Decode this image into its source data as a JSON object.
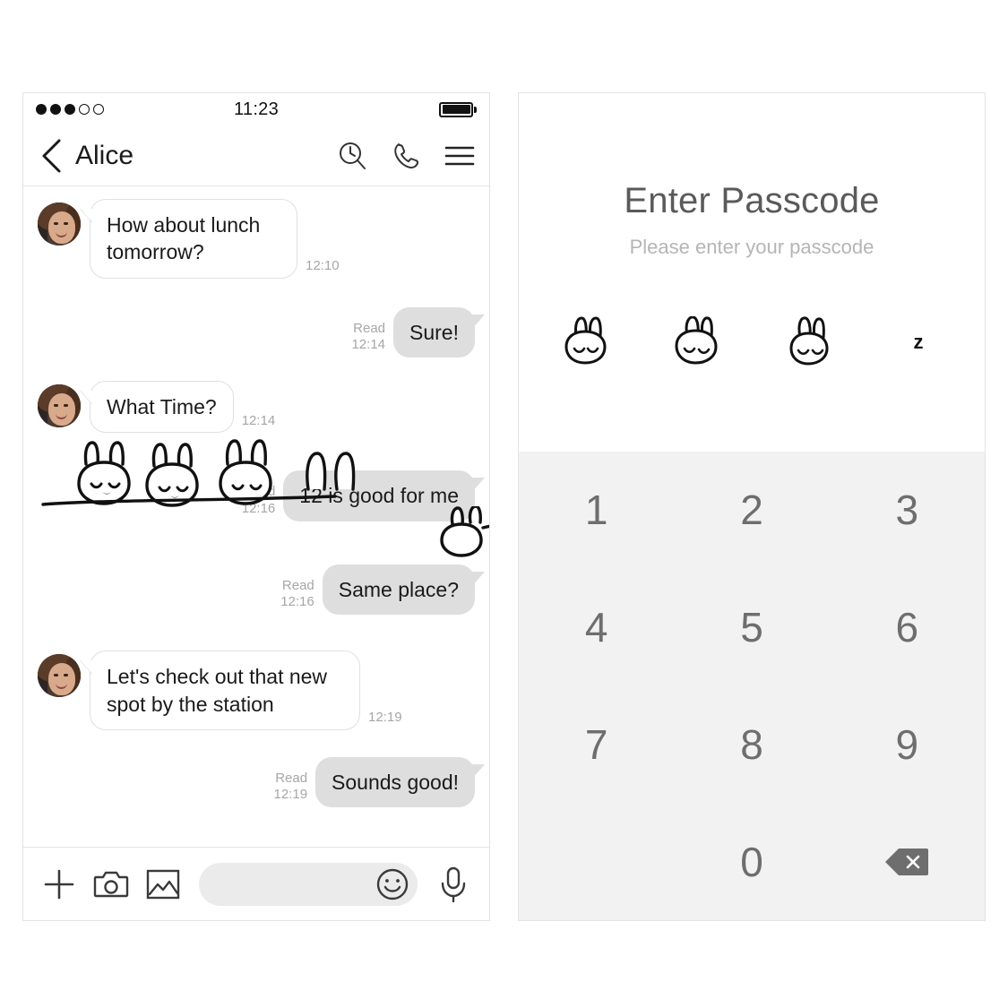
{
  "chat": {
    "statusbar": {
      "time": "11:23",
      "signal_filled": 3,
      "signal_total": 5,
      "battery_icon": "battery-full-icon"
    },
    "header": {
      "back_icon": "chevron-left-icon",
      "title": "Alice",
      "icons": [
        "clock-search-icon",
        "phone-icon",
        "hamburger-menu-icon"
      ]
    },
    "messages": [
      {
        "side": "in",
        "text": "How about lunch tomorrow?",
        "time": "12:10",
        "read": ""
      },
      {
        "side": "out",
        "text": "Sure!",
        "time": "12:14",
        "read": "Read"
      },
      {
        "side": "in",
        "text": "What Time?",
        "time": "12:14",
        "read": ""
      },
      {
        "side": "out",
        "text": "12 is good for me",
        "time": "12:16",
        "read": "Read"
      },
      {
        "side": "out",
        "text": "Same place?",
        "time": "12:16",
        "read": "Read"
      },
      {
        "side": "in",
        "text": "Let's check out that new spot by the station",
        "time": "12:19",
        "read": ""
      },
      {
        "side": "out",
        "text": "Sounds good!",
        "time": "12:19",
        "read": "Read"
      }
    ],
    "sticker": {
      "name": "sleeping-bunnies-sticker"
    },
    "input_bar": {
      "placeholder": "",
      "value": "",
      "tools": [
        "plus-icon",
        "camera-icon",
        "photo-gallery-icon",
        "emoji-smiley-icon",
        "microphone-icon"
      ]
    }
  },
  "passcode": {
    "title": "Enter Passcode",
    "subtitle": "Please enter your passcode",
    "entered_count": 3,
    "total_slots": 4,
    "empty_slot_glyph": "z",
    "filled_slot_icon": "bunny-face-icon",
    "keys": [
      "1",
      "2",
      "3",
      "4",
      "5",
      "6",
      "7",
      "8",
      "9",
      "",
      "0",
      "delete-icon"
    ],
    "delete_label": "delete-icon"
  },
  "colors": {
    "bubble_out": "#dedede",
    "bubble_in": "#ffffff",
    "panel_border": "#e3e3e3",
    "keypad_bg": "#f2f2f2",
    "key_text": "#6e6e6e",
    "title_text": "#5a5a5a",
    "sub_text": "#b5b5b5",
    "meta_text": "#a6a6a6"
  }
}
